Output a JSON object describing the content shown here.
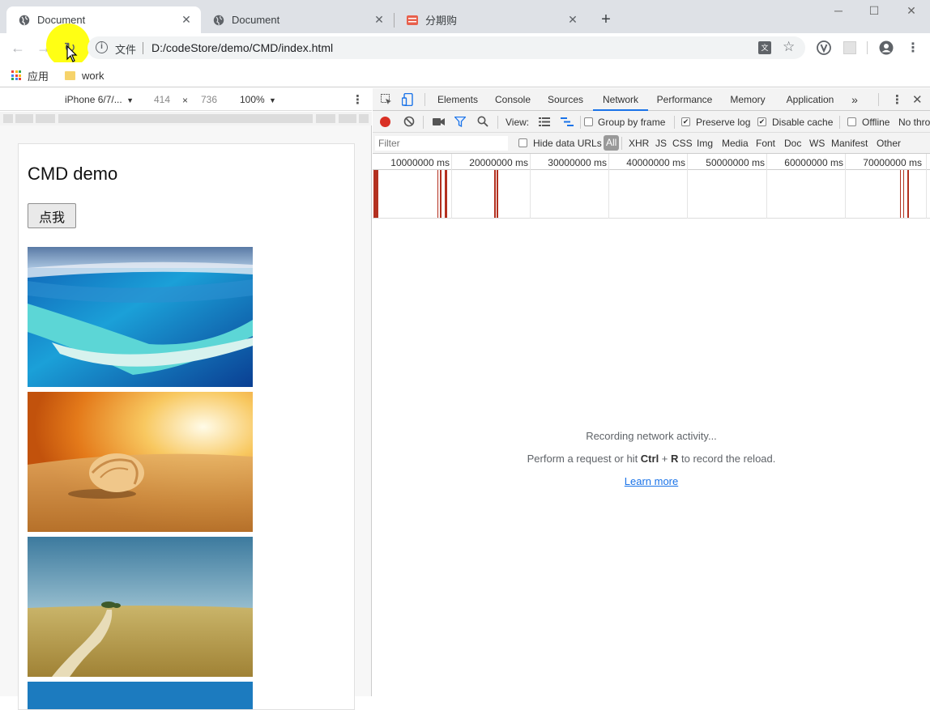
{
  "tabs": [
    {
      "title": "Document",
      "icon": "globe-icon",
      "active": true
    },
    {
      "title": "Document",
      "icon": "globe-icon",
      "active": false
    },
    {
      "title": "分期购",
      "icon": "shop-favicon-icon",
      "active": false
    }
  ],
  "new_tab_label": "+",
  "omnibox": {
    "security_label": "文件",
    "url": "D:/codeStore/demo/CMD/index.html"
  },
  "bookmarks": [
    {
      "label": "应用",
      "icon": "apps-grid-icon"
    },
    {
      "label": "work",
      "icon": "folder-icon"
    }
  ],
  "device_toolbar": {
    "device": "iPhone 6/7/...",
    "width": "414",
    "times": "×",
    "height": "736",
    "zoom": "100%"
  },
  "page": {
    "heading": "CMD demo",
    "button_label": "点我",
    "photos": [
      "ocean-reef-photo",
      "seashell-sunset-photo",
      "grassland-road-photo",
      "sky-photo"
    ]
  },
  "devtools": {
    "tabs": [
      "Elements",
      "Console",
      "Sources",
      "Network",
      "Performance",
      "Memory",
      "Application"
    ],
    "selected_tab": "Network",
    "more_label": "»",
    "toolbar": {
      "view_label": "View:",
      "group_by_frame": {
        "label": "Group by frame",
        "checked": false
      },
      "preserve_log": {
        "label": "Preserve log",
        "checked": true
      },
      "disable_cache": {
        "label": "Disable cache",
        "checked": true
      },
      "offline": {
        "label": "Offline",
        "checked": false
      },
      "throttle_label": "No thro"
    },
    "filter_bar": {
      "filter_placeholder": "Filter",
      "hide_data_urls": {
        "label": "Hide data URLs",
        "checked": false
      },
      "types": [
        "All",
        "XHR",
        "JS",
        "CSS",
        "Img",
        "Media",
        "Font",
        "Doc",
        "WS",
        "Manifest",
        "Other"
      ],
      "selected_type": "All"
    },
    "timeline_ticks": [
      "10000000 ms",
      "20000000 ms",
      "30000000 ms",
      "40000000 ms",
      "50000000 ms",
      "60000000 ms",
      "70000000 ms"
    ],
    "empty_state": {
      "line1": "Recording network activity...",
      "line2_prefix": "Perform a request or hit ",
      "line2_key1": "Ctrl",
      "line2_plus": " + ",
      "line2_key2": "R",
      "line2_suffix": " to record the reload.",
      "learn_more": "Learn more"
    }
  },
  "colors": {
    "accent": "#1a73e8",
    "record": "#d93025",
    "waterfall_bar": "#b3301f",
    "cursor_highlight": "#ffff00"
  }
}
